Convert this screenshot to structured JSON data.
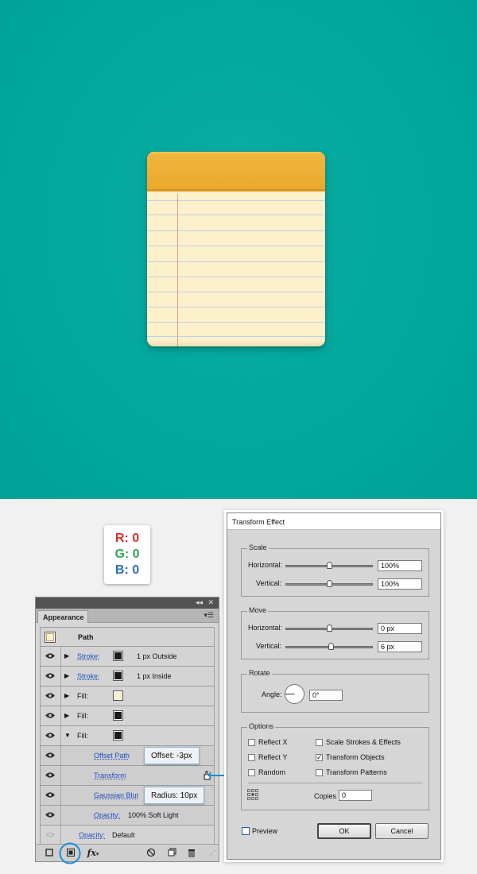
{
  "artwork": {
    "background_color": "#00a89d",
    "notepad_header_color": "#eeb038",
    "notepad_paper_color": "#fdf0cc",
    "rule_color": "#bcd4dc",
    "margin_color": "#f09a87"
  },
  "color_swatch": {
    "r": "R: 0",
    "g": "G: 0",
    "b": "B: 0",
    "r_color": "#d9322b",
    "g_color": "#2fa84f",
    "b_color": "#2f6fbb"
  },
  "appearance": {
    "tab_label": "Appearance",
    "object_label": "Path",
    "rows": [
      {
        "kind": "stroke",
        "label": "Stroke:",
        "detail": "1 px  Outside",
        "swatch": "#1a1a1a"
      },
      {
        "kind": "stroke",
        "label": "Stroke:",
        "detail": "1 px  Inside",
        "swatch": "#1a1a1a"
      },
      {
        "kind": "fill",
        "label": "Fill:",
        "swatch": "#fdf0cc"
      },
      {
        "kind": "fill",
        "label": "Fill:",
        "swatch": "#1a1a1a"
      },
      {
        "kind": "fill",
        "label": "Fill:",
        "swatch": "#1a1a1a",
        "expanded": true
      }
    ],
    "effects": [
      {
        "label": "Offset Path"
      },
      {
        "label": "Transform"
      },
      {
        "label": "Gaussian Blur"
      },
      {
        "label": "Opacity:",
        "value": "100% Soft Light"
      }
    ],
    "opacity_label": "Opacity:",
    "opacity_value": "Default",
    "fx_label": "fx"
  },
  "callouts": {
    "offset": "Offset: -3px",
    "radius": "Radius: 10px"
  },
  "dialog": {
    "title": "Transform Effect",
    "scale_label": "Scale",
    "scale_h_label": "Horizontal:",
    "scale_h_value": "100%",
    "scale_v_label": "Vertical:",
    "scale_v_value": "100%",
    "move_label": "Move",
    "move_h_label": "Horizontal:",
    "move_h_value": "0 px",
    "move_v_label": "Vertical:",
    "move_v_value": "6 px",
    "rotate_label": "Rotate",
    "angle_label": "Angle:",
    "angle_value": "0°",
    "options_label": "Options",
    "reflect_x": "Reflect X",
    "reflect_y": "Reflect Y",
    "random": "Random",
    "scale_strokes": "Scale Strokes & Effects",
    "transform_objects": "Transform Objects",
    "transform_patterns": "Transform Patterns",
    "transform_objects_checked": true,
    "copies_label": "Copies",
    "copies_value": "0",
    "preview_label": "Preview",
    "ok_label": "OK",
    "cancel_label": "Cancel"
  }
}
